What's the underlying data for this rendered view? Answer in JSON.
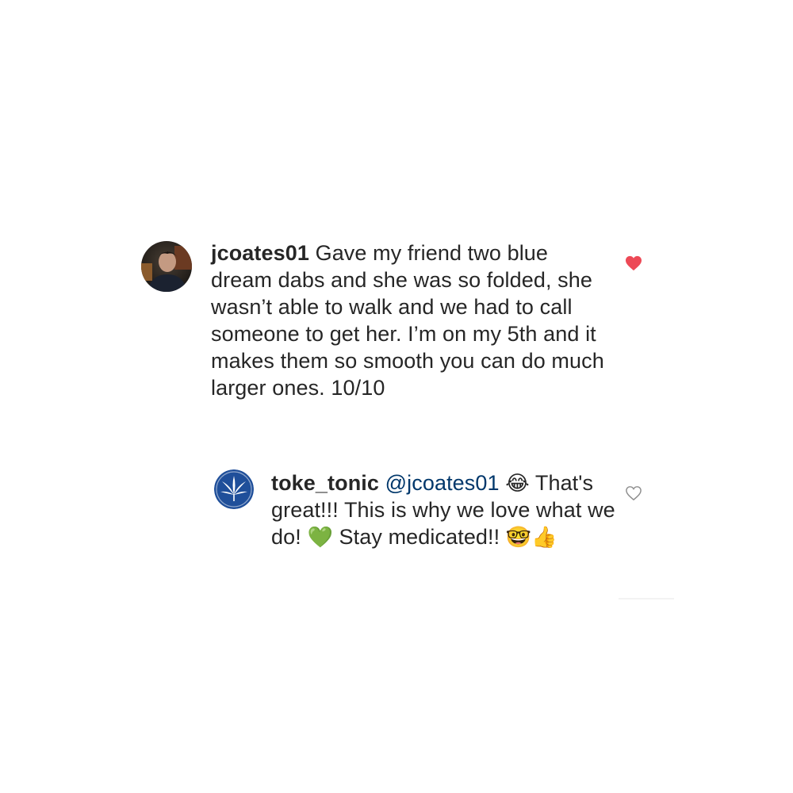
{
  "comments": [
    {
      "username": "jcoates01",
      "text": "Gave my friend two blue dream dabs and she was so folded, she wasn’t able to walk and we had to call someone to get her. I’m on my 5th and it makes them so smooth you can do much larger ones. 10/10",
      "liked": true,
      "heart_color": "#ed4956",
      "avatar": "profile-photo"
    },
    {
      "username": "toke_tonic",
      "mention": "@jcoates01",
      "emoji_1": "😂",
      "text_1": "That's great!!! This is why we love what we do!",
      "emoji_2": "💚",
      "text_2": "Stay medicated!!",
      "emoji_3": "🤓👍",
      "liked": false,
      "avatar": "cannabis-leaf-logo",
      "avatar_color": "#1f4f9a"
    }
  ]
}
